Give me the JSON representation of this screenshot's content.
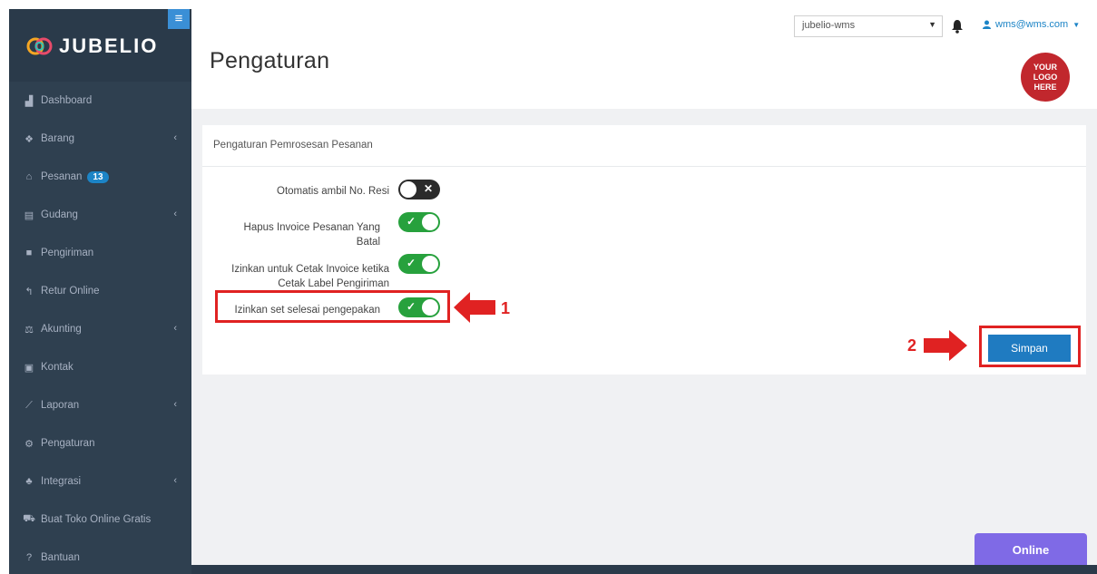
{
  "brand": {
    "name": "JUBELIO"
  },
  "sidebar": {
    "items": [
      {
        "label": "Dashboard",
        "icon": "chart-area-icon",
        "has_chevron": false
      },
      {
        "label": "Barang",
        "icon": "cubes-icon",
        "has_chevron": true
      },
      {
        "label": "Pesanan",
        "icon": "basket-icon",
        "has_chevron": false,
        "badge": "13"
      },
      {
        "label": "Gudang",
        "icon": "building-icon",
        "has_chevron": true
      },
      {
        "label": "Pengiriman",
        "icon": "truck-icon",
        "has_chevron": false
      },
      {
        "label": "Retur Online",
        "icon": "reply-icon",
        "has_chevron": false
      },
      {
        "label": "Akunting",
        "icon": "balance-scale-icon",
        "has_chevron": true
      },
      {
        "label": "Kontak",
        "icon": "address-card-icon",
        "has_chevron": false
      },
      {
        "label": "Laporan",
        "icon": "line-chart-icon",
        "has_chevron": true
      },
      {
        "label": "Pengaturan",
        "icon": "cogs-icon",
        "has_chevron": false
      },
      {
        "label": "Integrasi",
        "icon": "sitemap-icon",
        "has_chevron": true
      },
      {
        "label": "Buat Toko Online Gratis",
        "icon": "shopping-cart-icon",
        "has_chevron": false
      },
      {
        "label": "Bantuan",
        "icon": "question-circle-icon",
        "has_chevron": false
      }
    ]
  },
  "header": {
    "page_title": "Pengaturan",
    "warehouse_select": "jubelio-wms",
    "user_email": "wms@wms.com",
    "logo_badge": [
      "YOUR",
      "LOGO",
      "HERE"
    ]
  },
  "panel": {
    "title": "Pengaturan Pemrosesan Pesanan",
    "settings": [
      {
        "label": "Otomatis ambil No. Resi",
        "enabled": false
      },
      {
        "label": "Hapus Invoice Pesanan Yang Batal",
        "enabled": true
      },
      {
        "label": "Izinkan untuk Cetak Invoice ketika Cetak Label Pengiriman",
        "enabled": true
      },
      {
        "label": "Izinkan set selesai pengepakan",
        "enabled": true
      }
    ],
    "save_label": "Simpan"
  },
  "annotations": {
    "step1": "1",
    "step2": "2",
    "color": "#e02222"
  },
  "chat": {
    "label": "Online"
  },
  "colors": {
    "sidebar": "#2f4050",
    "toggle_on": "#27a13d",
    "primary": "#1f7bc1",
    "chat": "#7f6ae6"
  }
}
